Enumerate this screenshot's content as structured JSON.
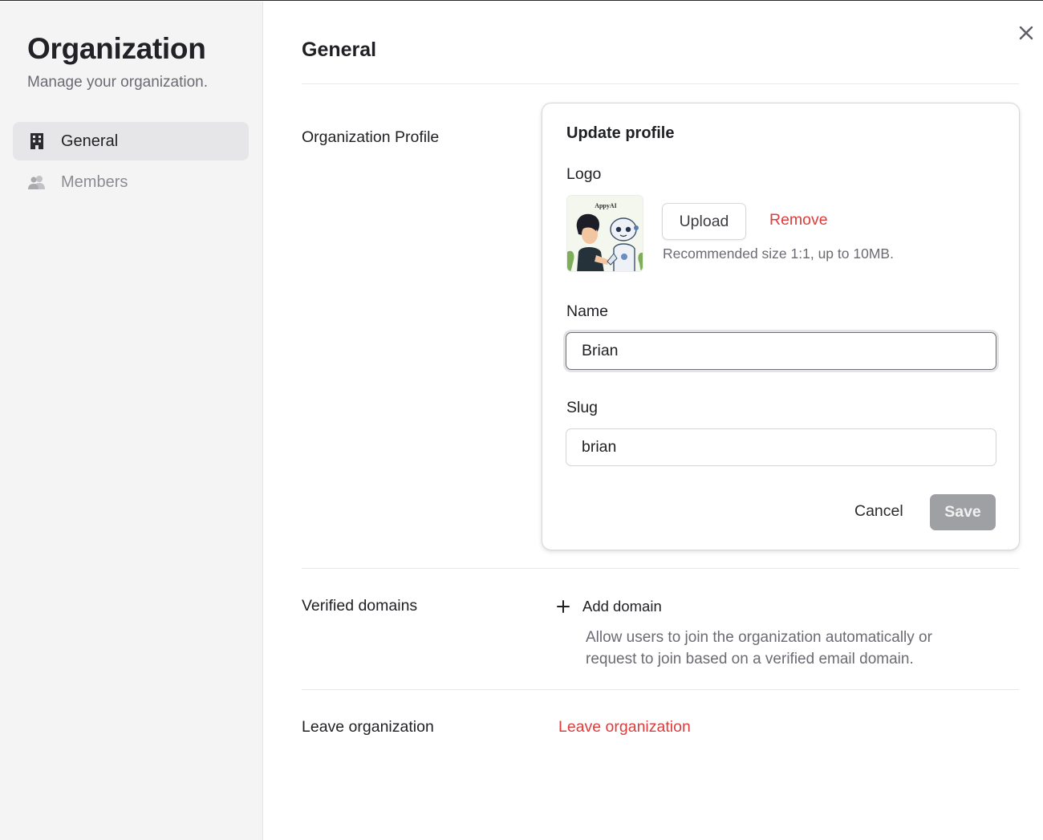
{
  "sidebar": {
    "title": "Organization",
    "subtitle": "Manage your organization.",
    "items": [
      {
        "label": "General",
        "icon": "building-icon",
        "active": true
      },
      {
        "label": "Members",
        "icon": "users-icon",
        "active": false
      }
    ]
  },
  "main": {
    "title": "General",
    "profile_section_label": "Organization Profile",
    "card": {
      "title": "Update profile",
      "logo_label": "Logo",
      "logo_text": "AppyAI",
      "upload_label": "Upload",
      "remove_label": "Remove",
      "hint": "Recommended size 1:1, up to 10MB.",
      "name_label": "Name",
      "name_value": "Brian",
      "slug_label": "Slug",
      "slug_value": "brian",
      "cancel_label": "Cancel",
      "save_label": "Save"
    },
    "domains": {
      "label": "Verified domains",
      "add_label": "Add domain",
      "hint": "Allow users to join the organization automatically or request to join based on a verified email domain."
    },
    "leave": {
      "label": "Leave organization",
      "link": "Leave organization"
    }
  },
  "colors": {
    "danger": "#dd3d3d",
    "sidebar_bg": "#f4f4f5",
    "save_disabled": "#9fa0a4"
  }
}
